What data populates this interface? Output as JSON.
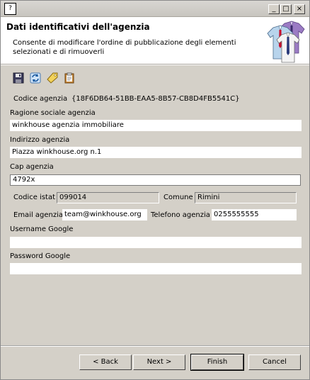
{
  "window": {
    "title": "",
    "app_icon": "?",
    "controls": {
      "minimize": "_",
      "maximize": "□",
      "close": "×"
    }
  },
  "header": {
    "title": "Dati identificativi dell'agenzia",
    "description": "Consente di modificare l'ordine di pubblicazione degli elementi selezionati e di rimuoverli",
    "image": "shirts-image"
  },
  "toolbar": {
    "icons": [
      "save-icon",
      "refresh-icon",
      "tag-icon",
      "clipboard-icon"
    ]
  },
  "form": {
    "codice_agenzia_label": "Codice agenzia",
    "codice_agenzia_value": "{18F6DB64-51BB-EAA5-8B57-CB8D4FB5541C}",
    "ragione_sociale_label": "Ragione sociale agenzia",
    "ragione_sociale_value": "winkhouse agenzia immobiliare",
    "indirizzo_label": "Indirizzo agenzia",
    "indirizzo_value": "Piazza winkhouse.org n.1",
    "cap_label": "Cap agenzia",
    "cap_value": "4792x",
    "codice_istat_label": "Codice istat",
    "codice_istat_value": "099014",
    "comune_label": "Comune",
    "comune_value": "Rimini",
    "email_label": "Email agenzia",
    "email_value": "team@winkhouse.org",
    "telefono_label": "Telefono agenzia",
    "telefono_value": "0255555555",
    "username_google_label": "Username Google",
    "username_google_value": "",
    "password_google_label": "Password Google",
    "password_google_value": ""
  },
  "buttons": {
    "back": "< Back",
    "next": "Next >",
    "finish": "Finish",
    "cancel": "Cancel"
  }
}
